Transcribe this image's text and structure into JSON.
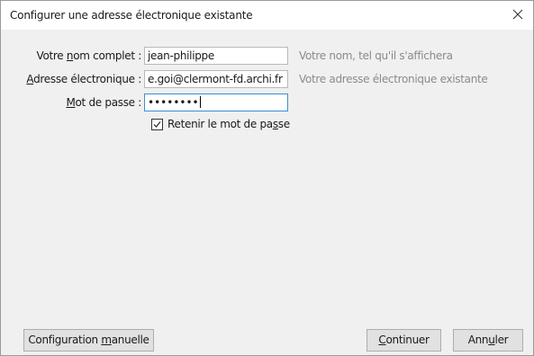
{
  "window": {
    "title": "Configurer une adresse électronique existante",
    "close_icon": "close-icon"
  },
  "form": {
    "name": {
      "label_pre": "Votre ",
      "label_mnemonic": "n",
      "label_post": "om complet :",
      "value": "jean-philippe",
      "hint": "Votre nom, tel qu'il s'affichera"
    },
    "email": {
      "label_mnemonic": "A",
      "label_post": "dresse électronique :",
      "value": "e.goi@clermont-fd.archi.fr",
      "hint": "Votre adresse électronique existante"
    },
    "password": {
      "label_mnemonic": "M",
      "label_post": "ot de passe :",
      "masked_value": "••••••••"
    },
    "remember": {
      "checked": true,
      "label_pre": "Retenir le mot de pa",
      "label_mnemonic": "s",
      "label_post": "se"
    }
  },
  "buttons": {
    "manual": {
      "pre": "Configuration ",
      "mnemonic": "m",
      "post": "anuelle"
    },
    "continue": {
      "pre": "",
      "mnemonic": "C",
      "post": "ontinuer"
    },
    "cancel": {
      "pre": "Ann",
      "mnemonic": "u",
      "post": "ler"
    }
  }
}
